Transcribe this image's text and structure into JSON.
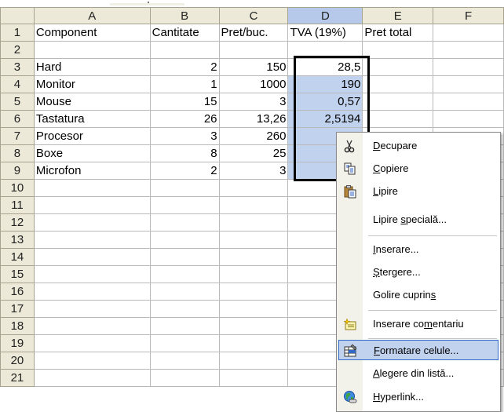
{
  "columns": [
    "A",
    "B",
    "C",
    "D",
    "E",
    "F"
  ],
  "row_numbers": [
    "1",
    "2",
    "3",
    "4",
    "5",
    "6",
    "7",
    "8",
    "9",
    "10",
    "11",
    "12",
    "13",
    "14",
    "15",
    "16",
    "17",
    "18",
    "19",
    "20",
    "21"
  ],
  "rows": [
    [
      "Component",
      "Cantitate",
      "Pret/buc.",
      "TVA (19%)",
      "Pret total",
      ""
    ],
    [
      "",
      "",
      "",
      "",
      "",
      ""
    ],
    [
      "Hard",
      "2",
      "150",
      "28,5",
      "",
      ""
    ],
    [
      "Monitor",
      "1",
      "1000",
      "190",
      "",
      ""
    ],
    [
      "Mouse",
      "15",
      "3",
      "0,57",
      "",
      ""
    ],
    [
      "Tastatura",
      "26",
      "13,26",
      "2,5194",
      "",
      ""
    ],
    [
      "Procesor",
      "3",
      "260",
      "",
      "",
      ""
    ],
    [
      "Boxe",
      "8",
      "25",
      "",
      "",
      ""
    ],
    [
      "Microfon",
      "2",
      "3",
      "",
      "",
      ""
    ]
  ],
  "context_menu": {
    "items": [
      {
        "pre": "",
        "ul": "D",
        "post": "ecupare",
        "icon": "cut-icon"
      },
      {
        "pre": "",
        "ul": "C",
        "post": "opiere",
        "icon": "copy-icon"
      },
      {
        "pre": "",
        "ul": "L",
        "post": "ipire",
        "icon": "paste-icon"
      },
      {
        "pre": "Lipire ",
        "ul": "s",
        "post": "pecială...",
        "icon": ""
      },
      {
        "pre": "",
        "ul": "I",
        "post": "nserare...",
        "icon": ""
      },
      {
        "pre": "",
        "ul": "Ș",
        "post": "tergere...",
        "icon": ""
      },
      {
        "pre": "Golire cuprin",
        "ul": "s",
        "post": "",
        "icon": ""
      },
      {
        "pre": "Inserare co",
        "ul": "m",
        "post": "entariu",
        "icon": "comment-icon"
      },
      {
        "pre": "",
        "ul": "F",
        "post": "ormatare celule...",
        "icon": "format-cells-icon"
      },
      {
        "pre": "",
        "ul": "A",
        "post": "legere din listă...",
        "icon": ""
      },
      {
        "pre": "",
        "ul": "H",
        "post": "yperlink...",
        "icon": "hyperlink-icon"
      }
    ]
  },
  "colors": {
    "header_bg": "#ece9d8",
    "selection_bg": "#c1d2ee",
    "menu_highlight": "#c1d2ee",
    "menu_highlight_border": "#316ac5"
  }
}
